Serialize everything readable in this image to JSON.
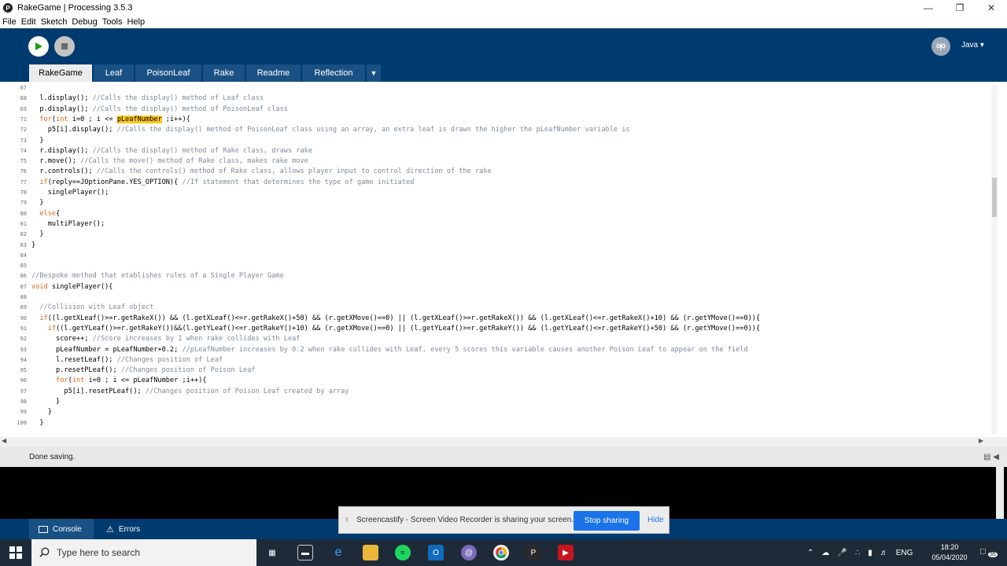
{
  "window": {
    "title": "RakeGame | Processing 3.5.3"
  },
  "menu": [
    "File",
    "Edit",
    "Sketch",
    "Debug",
    "Tools",
    "Help"
  ],
  "toolbar": {
    "mode": "Java ▾"
  },
  "tabs": [
    "RakeGame",
    "Leaf",
    "PoisonLeaf",
    "Rake",
    "Readme",
    "Reflection"
  ],
  "editor": {
    "lines": [
      {
        "n": "67",
        "code": ""
      },
      {
        "n": "68",
        "code": "  l.display(); //Calls the display() method of Leaf class"
      },
      {
        "n": "69",
        "code": "  p.display(); //Calls the display() method of PoisonLeaf class"
      },
      {
        "n": "71",
        "code": "  for(int i=0 ; i <= pLeafNumber ;i++){"
      },
      {
        "n": "72",
        "code": "    p5[i].display(); //Calls the display() method of PoisonLeaf class using an array, an extra leaf is drawn the higher the pLeafNumber variable is"
      },
      {
        "n": "73",
        "code": "  }"
      },
      {
        "n": "74",
        "code": "  r.display(); //Calls the display() method of Rake class, draws rake"
      },
      {
        "n": "75",
        "code": "  r.move(); //Calls the move() method of Rake class, makes rake move"
      },
      {
        "n": "76",
        "code": "  r.controls(); //Calls the controls() method of Rake class, allows player input to control direction of the rake"
      },
      {
        "n": "77",
        "code": "  if(reply==JOptionPane.YES_OPTION){ //If statement that determines the type of game initiated"
      },
      {
        "n": "78",
        "code": "    singlePlayer();"
      },
      {
        "n": "79",
        "code": "  }"
      },
      {
        "n": "80",
        "code": "  else{"
      },
      {
        "n": "81",
        "code": "    multiPlayer();"
      },
      {
        "n": "82",
        "code": "  }"
      },
      {
        "n": "83",
        "code": "}"
      },
      {
        "n": "84",
        "code": ""
      },
      {
        "n": "85",
        "code": ""
      },
      {
        "n": "86",
        "code": "//Bespoke method that etablishes rules of a Single Player Game"
      },
      {
        "n": "87",
        "code": "void singlePlayer(){"
      },
      {
        "n": "88",
        "code": ""
      },
      {
        "n": "89",
        "code": "  //Collision with Leaf object"
      },
      {
        "n": "90",
        "code": "  if((l.getXLeaf()>=r.getRakeX()) && (l.getXLeaf()<=r.getRakeX()+50) && (r.getXMove()==0) || (l.getXLeaf()>=r.getRakeX()) && (l.getXLeaf()<=r.getRakeX()+10) && (r.getYMove()==0)){"
      },
      {
        "n": "91",
        "code": "    if((l.getYLeaf()>=r.getRakeY())&&(l.getYLeaf()<=r.getRakeY()+10) && (r.getXMove()==0) || (l.getYLeaf()>=r.getRakeY()) && (l.getYLeaf()<=r.getRakeY()+50) && (r.getYMove()==0)){"
      },
      {
        "n": "92",
        "code": "      score++; //Score increases by 1 when rake collides with Leaf"
      },
      {
        "n": "93",
        "code": "      pLeafNumber = pLeafNumber+0.2; //pLeafNumber increases by 0.2 when rake collides with Leaf, every 5 scores this variable causes another Poison Leaf to appear on the field"
      },
      {
        "n": "94",
        "code": "      l.resetLeaf(); //Changes position of Leaf"
      },
      {
        "n": "95",
        "code": "      p.resetPLeaf(); //Changes position of Poison Leaf"
      },
      {
        "n": "96",
        "code": "      for(int i=0 ; i <= pLeafNumber ;i++){"
      },
      {
        "n": "97",
        "code": "        p5[i].resetPLeaf(); //Changes position of Poison Leaf created by array"
      },
      {
        "n": "98",
        "code": "      }"
      },
      {
        "n": "99",
        "code": "    }"
      },
      {
        "n": "100",
        "code": "  }"
      }
    ]
  },
  "status": {
    "message": "Done saving."
  },
  "console_tabs": [
    "Console",
    "Errors"
  ],
  "screencast": {
    "message": "Screencastify - Screen Video Recorder is sharing your screen.",
    "stop_label": "Stop sharing",
    "hide_label": "Hide"
  },
  "taskbar": {
    "search_placeholder": "Type here to search",
    "language": "ENG",
    "time": "18:20",
    "date": "05/04/2020",
    "notifications": "35"
  },
  "colors": {
    "processing_blue": "#003b6f",
    "tab_blue": "#1a5184",
    "keyword": "#e2661a",
    "comment": "#7d8b99",
    "highlight": "#ffc91b",
    "taskbar": "#1f2a38",
    "stop_button": "#1a73e8"
  }
}
